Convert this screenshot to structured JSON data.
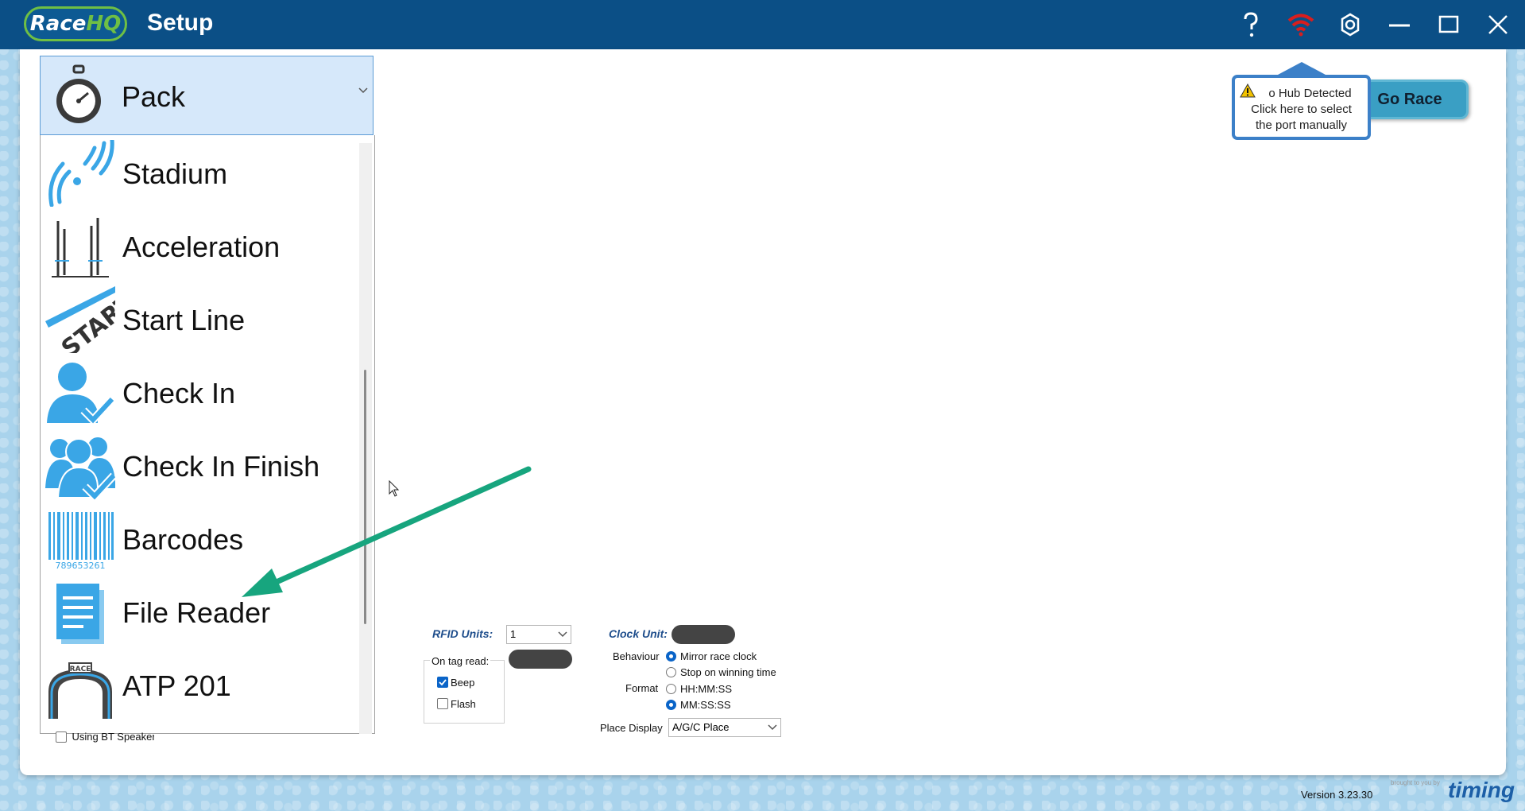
{
  "titlebar": {
    "logo_race": "Race",
    "logo_hq": "HQ",
    "title": "Setup"
  },
  "dropdown": {
    "selected": "Pack",
    "items": [
      {
        "label": "Stadium",
        "icon": "stadium-signal-icon"
      },
      {
        "label": "Acceleration",
        "icon": "acceleration-poles-icon"
      },
      {
        "label": "Start Line",
        "icon": "start-line-icon"
      },
      {
        "label": "Check In",
        "icon": "check-in-person-icon"
      },
      {
        "label": "Check In Finish",
        "icon": "check-in-group-icon"
      },
      {
        "label": "Barcodes",
        "icon": "barcode-icon"
      },
      {
        "label": "File Reader",
        "icon": "file-document-icon"
      },
      {
        "label": "ATP 201",
        "icon": "atp-gate-icon"
      }
    ],
    "barcode_number": "789653261",
    "atp_badge": "RACE"
  },
  "tooltip": {
    "line1": "o Hub Detected",
    "line2": "Click here to select",
    "line3": "the port manually"
  },
  "go_race": "Go Race",
  "rfid": {
    "label": "RFID Units:",
    "value": "1",
    "on_tag_read": "On tag read:",
    "beep": "Beep",
    "flash": "Flash",
    "beep_checked": true,
    "flash_checked": false
  },
  "clock": {
    "label": "Clock Unit:",
    "behaviour_label": "Behaviour",
    "behaviour_opt1": "Mirror race clock",
    "behaviour_opt2": "Stop on winning time",
    "format_label": "Format",
    "format_opt1": "HH:MM:SS",
    "format_opt2": "MM:SS:SS",
    "place_label": "Place Display",
    "place_value": "A/G/C Place"
  },
  "bt_speaker": "Using BT Speaker",
  "footer": {
    "version": "Version 3.23.30",
    "brand_by": "brought to you by",
    "brand": "timing"
  },
  "colors": {
    "titlebar": "#0b4f86",
    "accent_green": "#6fbf44",
    "icon_blue": "#3aa6e6",
    "arrow_green": "#17a57e",
    "wifi_red": "#d81e1e"
  }
}
